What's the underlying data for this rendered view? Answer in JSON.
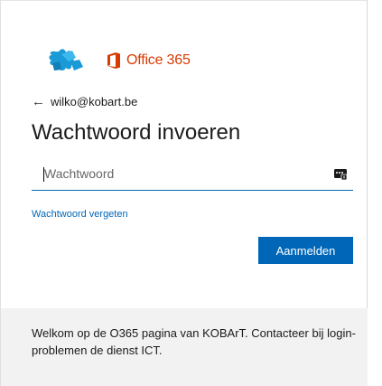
{
  "branding": {
    "org_logo": "kobart-puzzle-logo",
    "product_icon": "office-icon",
    "product_name": "Office 365",
    "accent_color": "#d83b01"
  },
  "account": {
    "back_icon": "back-arrow-icon",
    "email": "wilko@kobart.be"
  },
  "page_title": "Wachtwoord invoeren",
  "password": {
    "placeholder": "Wachtwoord",
    "value": "",
    "reveal_icon": "password-key-icon"
  },
  "forgot_link": "Wachtwoord vergeten",
  "signin_button": "Aanmelden",
  "primary_color": "#0067b8",
  "footer": {
    "message": "Welkom op de O365 pagina van KOBArT. Contacteer bij login-problemen de dienst ICT."
  }
}
